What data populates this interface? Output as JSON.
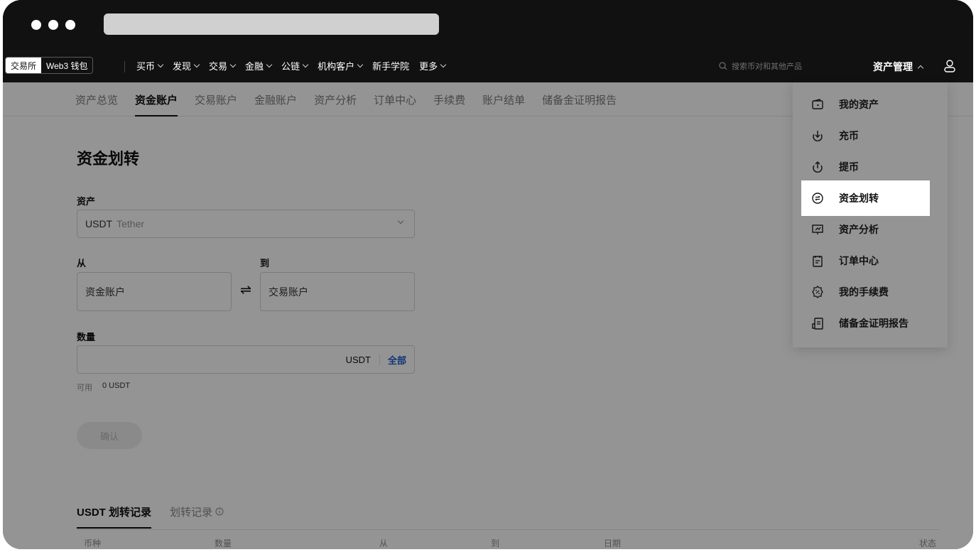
{
  "topnav": {
    "segment": {
      "exchange": "交易所",
      "web3": "Web3 钱包"
    },
    "items": [
      {
        "label": "买币",
        "has_chevron": true
      },
      {
        "label": "发现",
        "has_chevron": true
      },
      {
        "label": "交易",
        "has_chevron": true
      },
      {
        "label": "金融",
        "has_chevron": true
      },
      {
        "label": "公链",
        "has_chevron": true
      },
      {
        "label": "机构客户",
        "has_chevron": true
      },
      {
        "label": "新手学院",
        "has_chevron": false
      },
      {
        "label": "更多",
        "has_chevron": true
      }
    ],
    "search_placeholder": "搜索币对和其他产品",
    "asset_management": "资产管理"
  },
  "subnav": {
    "items": [
      "资产总览",
      "资金账户",
      "交易账户",
      "金融账户",
      "资产分析",
      "订单中心",
      "手续费",
      "账户结单",
      "储备金证明报告"
    ],
    "active_index": 1
  },
  "transfer": {
    "title": "资金划转",
    "asset_label": "资产",
    "asset_symbol": "USDT",
    "asset_name": "Tether",
    "from_label": "从",
    "from_value": "资金账户",
    "to_label": "到",
    "to_value": "交易账户",
    "amount_label": "数量",
    "amount_unit": "USDT",
    "all_button": "全部",
    "available_label": "可用",
    "available_value": "0 USDT",
    "confirm_button": "确认"
  },
  "records": {
    "tabs": [
      "USDT 划转记录",
      "划转记录"
    ],
    "columns": [
      "币种",
      "数量",
      "从",
      "到",
      "日期",
      "状态"
    ]
  },
  "dropdown": {
    "items": [
      {
        "label": "我的资产",
        "icon": "wallet-icon"
      },
      {
        "label": "充币",
        "icon": "deposit-icon"
      },
      {
        "label": "提币",
        "icon": "withdraw-icon"
      },
      {
        "label": "资金划转",
        "icon": "transfer-icon",
        "highlighted": true
      },
      {
        "label": "资产分析",
        "icon": "analysis-icon"
      },
      {
        "label": "订单中心",
        "icon": "order-center-icon"
      },
      {
        "label": "我的手续费",
        "icon": "fee-icon"
      },
      {
        "label": "储备金证明报告",
        "icon": "proof-of-reserves-icon"
      }
    ]
  },
  "colors": {
    "accent_blue": "#1a5ecf",
    "dark_bg": "#111111"
  }
}
